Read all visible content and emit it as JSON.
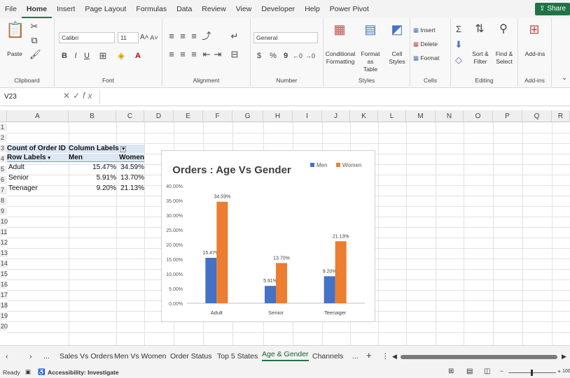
{
  "menubar": {
    "items": [
      "File",
      "Home",
      "Insert",
      "Page Layout",
      "Formulas",
      "Data",
      "Review",
      "View",
      "Developer",
      "Help",
      "Power Pivot"
    ],
    "active_index": 1,
    "share_label": "Share"
  },
  "ribbon": {
    "clipboard": {
      "paste_label": "Paste",
      "group_label": "Clipboard"
    },
    "font": {
      "font_name": "Calibri",
      "font_size": "11",
      "grow": "A˄",
      "shrink": "A˅",
      "bold": "B",
      "italic": "I",
      "underline": "U",
      "group_label": "Font"
    },
    "alignment": {
      "group_label": "Alignment"
    },
    "number": {
      "format": "General",
      "currency": "$",
      "percent": "%",
      "comma": "9",
      "group_label": "Number"
    },
    "styles": {
      "conditional_line1": "Conditional",
      "conditional_line2": "Formatting",
      "format_table_line1": "Format as",
      "format_table_line2": "Table",
      "cell_styles_line1": "Cell",
      "cell_styles_line2": "Styles",
      "group_label": "Styles"
    },
    "cells": {
      "insert": "Insert",
      "delete": "Delete",
      "format": "Format",
      "group_label": "Cells"
    },
    "editing": {
      "sort_line1": "Sort &",
      "sort_line2": "Filter",
      "find_line1": "Find &",
      "find_line2": "Select",
      "group_label": "Editing"
    },
    "addins": {
      "label": "Add-ins",
      "group_label": "Add-ins"
    }
  },
  "formula_bar": {
    "cell_ref": "V23",
    "fx": "fx",
    "value": ""
  },
  "columns": [
    "A",
    "B",
    "C",
    "D",
    "E",
    "F",
    "G",
    "H",
    "I",
    "J",
    "K",
    "L",
    "M",
    "N",
    "O",
    "P",
    "Q",
    "R"
  ],
  "rows": [
    "1",
    "2",
    "3",
    "4",
    "5",
    "6",
    "7",
    "8",
    "9",
    "10",
    "11",
    "12",
    "13",
    "14",
    "15",
    "16",
    "17",
    "18",
    "19",
    "20"
  ],
  "pivot": {
    "header_a3": "Count of Order ID",
    "header_b3": "Column Labels",
    "row_labels": "Row Labels",
    "col_men": "Men",
    "col_women": "Women",
    "rows": [
      {
        "label": "Adult",
        "men": "15.47%",
        "women": "34.59%"
      },
      {
        "label": "Senior",
        "men": "5.91%",
        "women": "13.70%"
      },
      {
        "label": "Teenager",
        "men": "9.20%",
        "women": "21.13%"
      }
    ]
  },
  "chart_data": {
    "type": "bar",
    "title": "Orders : Age Vs Gender",
    "categories": [
      "Adult",
      "Senior",
      "Teenager"
    ],
    "series": [
      {
        "name": "Men",
        "values": [
          15.47,
          5.91,
          9.2
        ],
        "color": "#4472c4"
      },
      {
        "name": "Women",
        "values": [
          34.59,
          13.7,
          21.13
        ],
        "color": "#ed7d31"
      }
    ],
    "data_labels": [
      [
        "15.47%",
        "5.91%",
        "9.20%"
      ],
      [
        "34.59%",
        "13.70%",
        "21.13%"
      ]
    ],
    "ylim": [
      0,
      40
    ],
    "yticks": [
      "0.00%",
      "5.00%",
      "10.00%",
      "15.00%",
      "20.00%",
      "25.00%",
      "30.00%",
      "35.00%",
      "40.00%"
    ],
    "legend_position": "top-right",
    "grid": false
  },
  "sheet_tabs": {
    "tabs": [
      "Sales Vs Orders",
      "Men Vs Women",
      "Order Status",
      "Top 5 States",
      "Age & Gender",
      "Channels"
    ],
    "active_index": 4,
    "more": "...",
    "add": "+"
  },
  "status": {
    "ready": "Ready",
    "accessibility": "Accessibility: Investigate",
    "zoom": "100"
  }
}
